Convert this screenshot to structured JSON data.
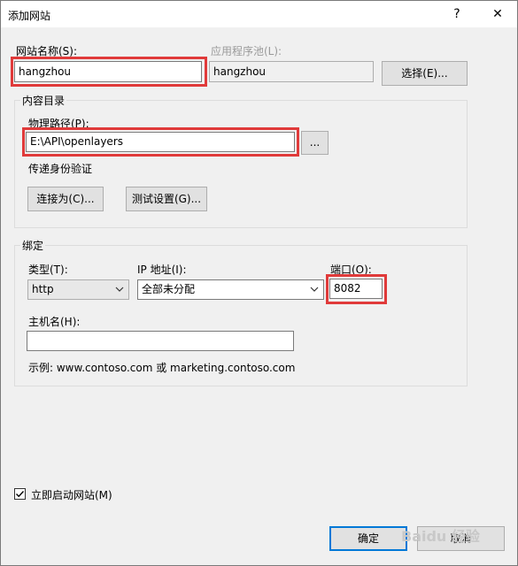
{
  "window": {
    "title": "添加网站",
    "help_label": "?",
    "close_label": "✕"
  },
  "site": {
    "name_label": "网站名称(S):",
    "name_value": "hangzhou",
    "pool_label": "应用程序池(L):",
    "pool_value": "hangzhou",
    "select_button": "选择(E)..."
  },
  "content": {
    "group_title": "内容目录",
    "path_label": "物理路径(P):",
    "path_value": "E:\\API\\openlayers",
    "browse_button": "...",
    "passthrough_label": "传递身份验证",
    "connect_as_button": "连接为(C)...",
    "test_settings_button": "测试设置(G)..."
  },
  "binding": {
    "group_title": "绑定",
    "type_label": "类型(T):",
    "type_value": "http",
    "ip_label": "IP 地址(I):",
    "ip_value": "全部未分配",
    "port_label": "端口(O):",
    "port_value": "8082",
    "host_label": "主机名(H):",
    "host_value": "",
    "example_text": "示例: www.contoso.com 或 marketing.contoso.com"
  },
  "start": {
    "checkbox_label": "立即启动网站(M)",
    "checked": true
  },
  "footer": {
    "ok_button": "确定",
    "cancel_button": "取消"
  },
  "watermark": "Baidu 经验"
}
